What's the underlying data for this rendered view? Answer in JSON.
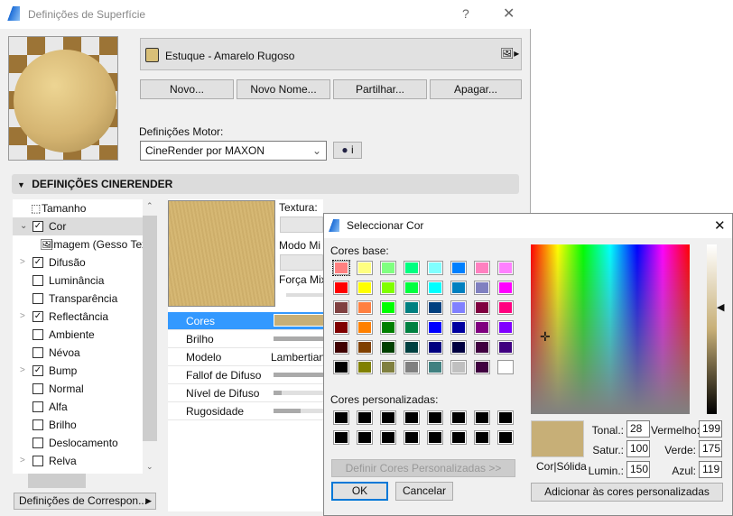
{
  "main": {
    "title": "Definições de Superfície",
    "help": "?",
    "material_name": "Estuque - Amarelo Rugoso",
    "material_color": "#d8bf78",
    "buttons": [
      "Novo...",
      "Novo Nome...",
      "Partilhar...",
      "Apagar..."
    ],
    "engine_label": "Definições Motor:",
    "engine_value": "CineRender por MAXON",
    "engine_info": "i",
    "section_title": "DEFINIÇÕES CINERENDER",
    "tree": [
      {
        "label": "Tamanho",
        "type": "icon"
      },
      {
        "label": "Cor",
        "checked": true,
        "expanded": true
      },
      {
        "label": "Imagem (Gesso Tex",
        "type": "child"
      },
      {
        "label": "Difusão",
        "checked": true,
        "expandable": true
      },
      {
        "label": "Luminância",
        "checked": false
      },
      {
        "label": "Transparência",
        "checked": false
      },
      {
        "label": "Reflectância",
        "checked": true,
        "expandable": true
      },
      {
        "label": "Ambiente",
        "checked": false
      },
      {
        "label": "Névoa",
        "checked": false
      },
      {
        "label": "Bump",
        "checked": true,
        "expandable": true
      },
      {
        "label": "Normal",
        "checked": false
      },
      {
        "label": "Alfa",
        "checked": false
      },
      {
        "label": "Brilho",
        "checked": false
      },
      {
        "label": "Deslocamento",
        "checked": false
      },
      {
        "label": "Relva",
        "checked": false,
        "expandable": true
      }
    ],
    "mapping_button": "Definições de Correspon...",
    "texture_label": "Textura:",
    "mix_mode_label": "Modo Mi",
    "mix_strength_label": "Força Mix",
    "props": [
      {
        "label": "Cores",
        "type": "color",
        "selected": true
      },
      {
        "label": "Brilho",
        "type": "slider",
        "value": 1.0
      },
      {
        "label": "Modelo",
        "type": "text",
        "value": "Lambertian"
      },
      {
        "label": "Fallof de Difuso",
        "type": "slider",
        "value": 1.0
      },
      {
        "label": "Nível de Difuso",
        "type": "slider",
        "value": 0.15
      },
      {
        "label": "Rugosidade",
        "type": "slider",
        "value": 0.5
      }
    ]
  },
  "dialog": {
    "title": "Seleccionar Cor",
    "base_label": "Cores base:",
    "custom_label": "Cores personalizadas:",
    "base_colors": [
      "#FF8080",
      "#FFFF80",
      "#80FF80",
      "#00FF80",
      "#80FFFF",
      "#0080FF",
      "#FF80C0",
      "#FF80FF",
      "#FF0000",
      "#FFFF00",
      "#80FF00",
      "#00FF40",
      "#00FFFF",
      "#0080C0",
      "#8080C0",
      "#FF00FF",
      "#804040",
      "#FF8040",
      "#00FF00",
      "#008080",
      "#004080",
      "#8080FF",
      "#800040",
      "#FF0080",
      "#800000",
      "#FF8000",
      "#008000",
      "#008040",
      "#0000FF",
      "#0000A0",
      "#800080",
      "#8000FF",
      "#400000",
      "#804000",
      "#004000",
      "#004040",
      "#000080",
      "#000040",
      "#400040",
      "#400080",
      "#000000",
      "#808000",
      "#808040",
      "#808080",
      "#408080",
      "#C0C0C0",
      "#400040",
      "#FFFFFF"
    ],
    "define_custom": "Definir Cores Personalizadas >>",
    "ok": "OK",
    "cancel": "Cancelar",
    "solid_label": "Cor|Sólida",
    "hue_label": "Tonal.:",
    "sat_label": "Satur.:",
    "lum_label": "Lumin.:",
    "red_label": "Vermelho:",
    "green_label": "Verde:",
    "blue_label": "Azul:",
    "hue": "28",
    "sat": "100",
    "lum": "150",
    "red": "199",
    "green": "175",
    "blue": "119",
    "current_color": "#c7af77",
    "add_custom": "Adicionar às cores personalizadas"
  }
}
